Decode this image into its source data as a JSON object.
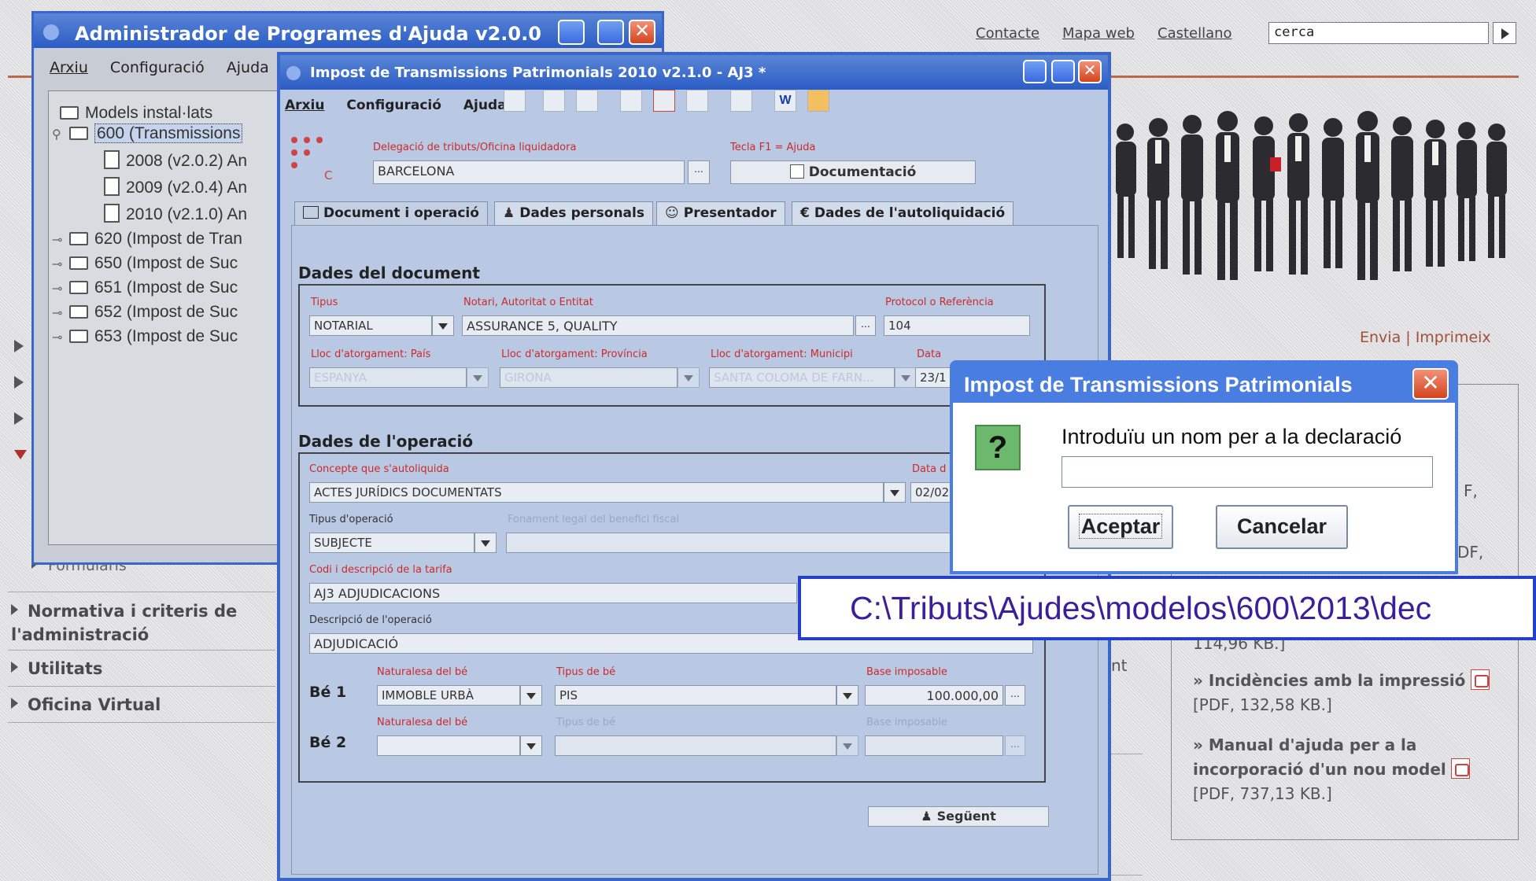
{
  "site": {
    "top_links": [
      "Contacte",
      "Mapa web",
      "Castellano"
    ],
    "search_value": "cerca",
    "share_links": "Envia | Imprimeix",
    "menu": [
      "Formularis",
      "Normativa i criteris de l'administració",
      "Utilitats",
      "Oficina Virtual"
    ],
    "right_links": [
      {
        "prefix": "» ",
        "title": "Incidències amb la impressió",
        "meta": "[PDF, 132,58 KB.]"
      },
      {
        "prefix": "» ",
        "title": "Manual d'ajuda per a la incorporació d'un nou model",
        "meta": "[PDF, 737,13 KB.]"
      }
    ],
    "partial_meta": "114,96 KB.]",
    "fragments": [
      "F,",
      "DF,",
      "nt"
    ]
  },
  "admin_window": {
    "title": "Administrador de Programes d'Ajuda v2.0.0",
    "menu": [
      "Arxiu",
      "Configuració",
      "Ajuda"
    ],
    "tree": [
      "Models instal·lats",
      "600 (Transmissions",
      "2008 (v2.0.2) An",
      "2009 (v2.0.4) An",
      "2010 (v2.1.0) An",
      "620 (Impost de Tran",
      "650 (Impost de Suc",
      "651 (Impost de Suc",
      "652 (Impost de Suc",
      "653 (Impost de Suc"
    ]
  },
  "itp_window": {
    "title": "Impost de Transmissions Patrimonials 2010 v2.1.0 - AJ3 *",
    "menu": [
      "Arxiu",
      "Configuració",
      "Ajuda"
    ],
    "delegacio_label": "Delegació de tributs/Oficina liquidadora",
    "delegacio_value": "BARCELONA",
    "help_hint": "Tecla F1 = Ajuda",
    "documentacio_button": "Documentació",
    "logo_text": "C",
    "tabs": [
      "Document i operació",
      "Dades personals",
      "Presentador",
      "Dades de l'autoliquidació"
    ],
    "doc_section": "Dades del document",
    "tipus_label": "Tipus",
    "tipus_value": "NOTARIAL",
    "notari_label": "Notari, Autoritat o Entitat",
    "notari_value": "ASSURANCE 5, QUALITY",
    "protocol_label": "Protocol o Referència",
    "protocol_value": "104",
    "pais_label": "Lloc d'atorgament: País",
    "pais_value": "ESPANYA",
    "provincia_label": "Lloc d'atorgament: Província",
    "provincia_value": "GIRONA",
    "municipi_label": "Lloc d'atorgament: Municipi",
    "municipi_value": "SANTA COLOMA DE FARN...",
    "data_label": "Data",
    "data_value": "23/1",
    "op_section": "Dades de l'operació",
    "concepte_label": "Concepte que s'autoliquida",
    "concepte_value": "ACTES JURÍDICS DOCUMENTATS",
    "data2_label": "Data d",
    "data2_value": "02/02",
    "tipus_op_label": "Tipus d'operació",
    "tipus_op_value": "SUBJECTE",
    "fonament_label": "Fonament legal del benefici fiscal",
    "codi_label": "Codi i descripció de la tarifa",
    "codi_value": "AJ3 ADJUDICACIONS",
    "descripcio_label": "Descripció de l'operació",
    "descripcio_value": "ADJUDICACIÓ",
    "be1_label": "Bé 1",
    "be2_label": "Bé 2",
    "naturalesa_label": "Naturalesa del bé",
    "naturalesa_value": "IMMOBLE URBÀ",
    "tipus_be_label": "Tipus de bé",
    "tipus_be_value": "PIS",
    "base_label": "Base imposable",
    "base_value": "100.000,00",
    "next_button": "Següent"
  },
  "dialog": {
    "title": "Impost de Transmissions Patrimonials",
    "prompt": "Introduïu un nom per a la declaració",
    "input_value": "",
    "ok": "Aceptar",
    "cancel": "Cancelar"
  },
  "path_caption": "C:\\Tributs\\Ajudes\\modelos\\600\\2013\\dec",
  "colors": {
    "accent_red": "#cc2a2a",
    "title_blue": "#2b5cc4",
    "caption_border": "#2540c8",
    "caption_text": "#3a1f9c"
  }
}
